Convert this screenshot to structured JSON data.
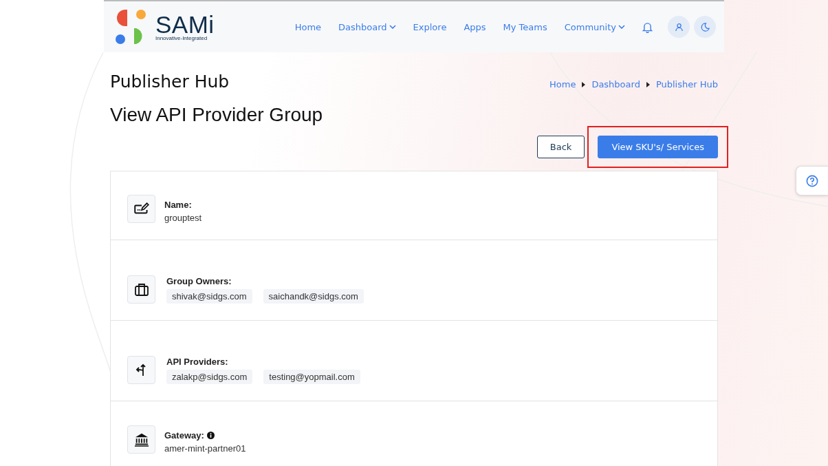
{
  "header": {
    "logo": {
      "word": "SAMi",
      "tagline": "Innovative-Integrated"
    },
    "nav": [
      {
        "label": "Home",
        "dropdown": false
      },
      {
        "label": "Dashboard",
        "dropdown": true
      },
      {
        "label": "Explore",
        "dropdown": false
      },
      {
        "label": "Apps",
        "dropdown": false
      },
      {
        "label": "My Teams",
        "dropdown": false
      },
      {
        "label": "Community",
        "dropdown": true
      }
    ]
  },
  "page": {
    "section_title": "Publisher Hub",
    "title": "View API Provider Group",
    "breadcrumb": [
      "Home",
      "Dashboard",
      "Publisher Hub"
    ],
    "buttons": [
      {
        "label": "Back",
        "kind": "outline",
        "highlighted": false
      },
      {
        "label": "View SKU's/ Services",
        "kind": "primary",
        "highlighted": true
      }
    ]
  },
  "details": [
    {
      "kind": "text",
      "label": "Name:",
      "value": "grouptest",
      "info": false
    },
    {
      "kind": "tags",
      "label": "Group Owners:",
      "tags": [
        "shivak@sidgs.com",
        "saichandk@sidgs.com"
      ]
    },
    {
      "kind": "tags",
      "label": "API Providers:",
      "tags": [
        "zalakp@sidgs.com",
        "testing@yopmail.com"
      ]
    },
    {
      "kind": "text",
      "label": "Gateway:",
      "value": "amer-mint-partner01",
      "info": true
    }
  ]
}
